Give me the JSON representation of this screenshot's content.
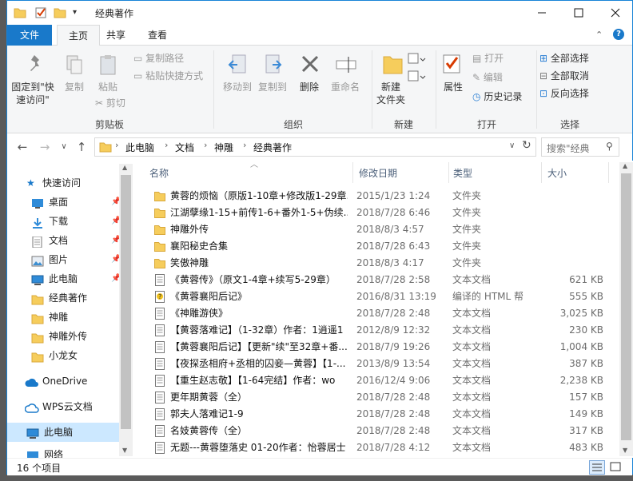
{
  "window": {
    "title": "经典著作",
    "minimize_icon": "minimize-icon",
    "maximize_icon": "maximize-icon",
    "close_icon": "close-icon",
    "qat_dropdown_symbol": "▾"
  },
  "ribbon_tabs": [
    "文件",
    "主页",
    "共享",
    "查看"
  ],
  "ribbon": {
    "clipboard": {
      "group_label": "剪贴板",
      "pin_line1": "固定到\"快",
      "pin_line2": "速访问\"",
      "copy": "复制",
      "paste": "粘贴",
      "cut": "剪切",
      "copy_path": "复制路径",
      "paste_shortcut": "粘贴快捷方式"
    },
    "organize": {
      "group_label": "组织",
      "move_to": "移动到",
      "copy_to": "复制到",
      "delete": "删除",
      "rename": "重命名"
    },
    "new": {
      "group_label": "新建",
      "new_folder_line1": "新建",
      "new_folder_line2": "文件夹"
    },
    "open": {
      "group_label": "打开",
      "properties": "属性",
      "open": "打开",
      "edit": "编辑",
      "history": "历史记录"
    },
    "select": {
      "group_label": "选择",
      "select_all": "全部选择",
      "select_none": "全部取消",
      "invert": "反向选择"
    }
  },
  "address": {
    "breadcrumbs": [
      "此电脑",
      "文档",
      "神雕",
      "经典著作"
    ],
    "search_placeholder": "搜索\"经典"
  },
  "nav": {
    "quick_access": "快速访问",
    "items": [
      {
        "label": "桌面",
        "icon": "desktop-icon",
        "pinned": true
      },
      {
        "label": "下载",
        "icon": "download-icon",
        "pinned": true
      },
      {
        "label": "文档",
        "icon": "document-icon",
        "pinned": true
      },
      {
        "label": "图片",
        "icon": "picture-icon",
        "pinned": true
      },
      {
        "label": "此电脑",
        "icon": "pc-icon",
        "pinned": true
      },
      {
        "label": "经典著作",
        "icon": "folder-icon",
        "pinned": false
      },
      {
        "label": "神雕",
        "icon": "folder-icon",
        "pinned": false
      },
      {
        "label": "神雕外传",
        "icon": "folder-icon",
        "pinned": false
      },
      {
        "label": "小龙女",
        "icon": "folder-icon",
        "pinned": false
      }
    ],
    "onedrive": "OneDrive",
    "wps": "WPS云文档",
    "this_pc": "此电脑",
    "network": "网络"
  },
  "columns": {
    "name": "名称",
    "date": "修改日期",
    "type": "类型",
    "size": "大小"
  },
  "files": [
    {
      "name": "黄蓉的烦恼（原版1-10章+修改版1-29章...",
      "date": "2015/1/23 1:24",
      "type": "文件夹",
      "size": "",
      "icon": "folder-icon"
    },
    {
      "name": "江湖孽缘1-15+前传1-6+番外1-5+伪续...",
      "date": "2018/7/28 6:46",
      "type": "文件夹",
      "size": "",
      "icon": "folder-icon"
    },
    {
      "name": "神雕外传",
      "date": "2018/8/3 4:57",
      "type": "文件夹",
      "size": "",
      "icon": "folder-icon"
    },
    {
      "name": "襄阳秘史合集",
      "date": "2018/7/28 6:43",
      "type": "文件夹",
      "size": "",
      "icon": "folder-icon"
    },
    {
      "name": "笑傲神雕",
      "date": "2018/8/3 4:17",
      "type": "文件夹",
      "size": "",
      "icon": "folder-icon"
    },
    {
      "name": "《黄蓉传》（原文1-4章+续写5-29章）",
      "date": "2018/7/28 2:58",
      "type": "文本文档",
      "size": "621 KB",
      "icon": "text-file-icon"
    },
    {
      "name": "《黄蓉襄阳后记》",
      "date": "2016/8/31 13:19",
      "type": "编译的 HTML 帮",
      "size": "555 KB",
      "icon": "chm-file-icon"
    },
    {
      "name": "《神雕游侠》",
      "date": "2018/7/28 2:48",
      "type": "文本文档",
      "size": "3,025 KB",
      "icon": "text-file-icon"
    },
    {
      "name": "【黄蓉落难记】（1-32章）作者：1逍遥1",
      "date": "2012/8/9 12:32",
      "type": "文本文档",
      "size": "230 KB",
      "icon": "text-file-icon"
    },
    {
      "name": "【黄蓉襄阳后记】【更新\"续\"至32章+番...",
      "date": "2018/7/9 19:26",
      "type": "文本文档",
      "size": "1,004 KB",
      "icon": "text-file-icon"
    },
    {
      "name": "【夜探丞相府+丞相的囚妾—黄蓉】【1-...",
      "date": "2013/8/9 13:54",
      "type": "文本文档",
      "size": "387 KB",
      "icon": "text-file-icon"
    },
    {
      "name": "【重生赵志敬】【1-64完结】作者：wo",
      "date": "2016/12/4 9:06",
      "type": "文本文档",
      "size": "2,238 KB",
      "icon": "text-file-icon"
    },
    {
      "name": "更年期黄蓉（全）",
      "date": "2018/7/28 2:48",
      "type": "文本文档",
      "size": "157 KB",
      "icon": "text-file-icon"
    },
    {
      "name": "郭夫人落难记1-9",
      "date": "2018/7/28 2:48",
      "type": "文本文档",
      "size": "149 KB",
      "icon": "text-file-icon"
    },
    {
      "name": "名妓黄蓉传（全）",
      "date": "2018/7/28 2:48",
      "type": "文本文档",
      "size": "317 KB",
      "icon": "text-file-icon"
    },
    {
      "name": "无题---黄蓉堕落史 01-20作者：怡蓉居士",
      "date": "2018/7/28 4:12",
      "type": "文本文档",
      "size": "483 KB",
      "icon": "text-file-icon"
    }
  ],
  "status": {
    "item_count": "16 个项目"
  },
  "colors": {
    "accent": "#1979ca",
    "selection": "#cce8ff",
    "folder": "#f6cd5c"
  }
}
